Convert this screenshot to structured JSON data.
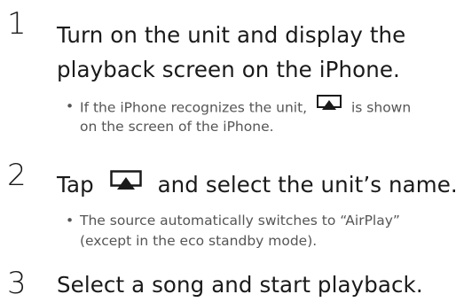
{
  "steps": [
    {
      "number": "1",
      "title_line1": "Turn on the unit and display the",
      "title_line2": "playback screen on the iPhone.",
      "note_line1_a": "If the iPhone recognizes the unit,",
      "note_line1_b": "is shown",
      "note_line2": "on the screen of the iPhone."
    },
    {
      "number": "2",
      "title_a": "Tap",
      "title_b": "and select the unit’s name.",
      "note_line1": "The source automatically switches to “AirPlay”",
      "note_line2": "(except in the eco standby mode)."
    },
    {
      "number": "3",
      "title": "Select a song and start playback."
    }
  ],
  "bullet_char": "•",
  "icons": {
    "airplay": "airplay-icon"
  },
  "colors": {
    "text": "#1a1a1a",
    "note_text": "#555555"
  }
}
